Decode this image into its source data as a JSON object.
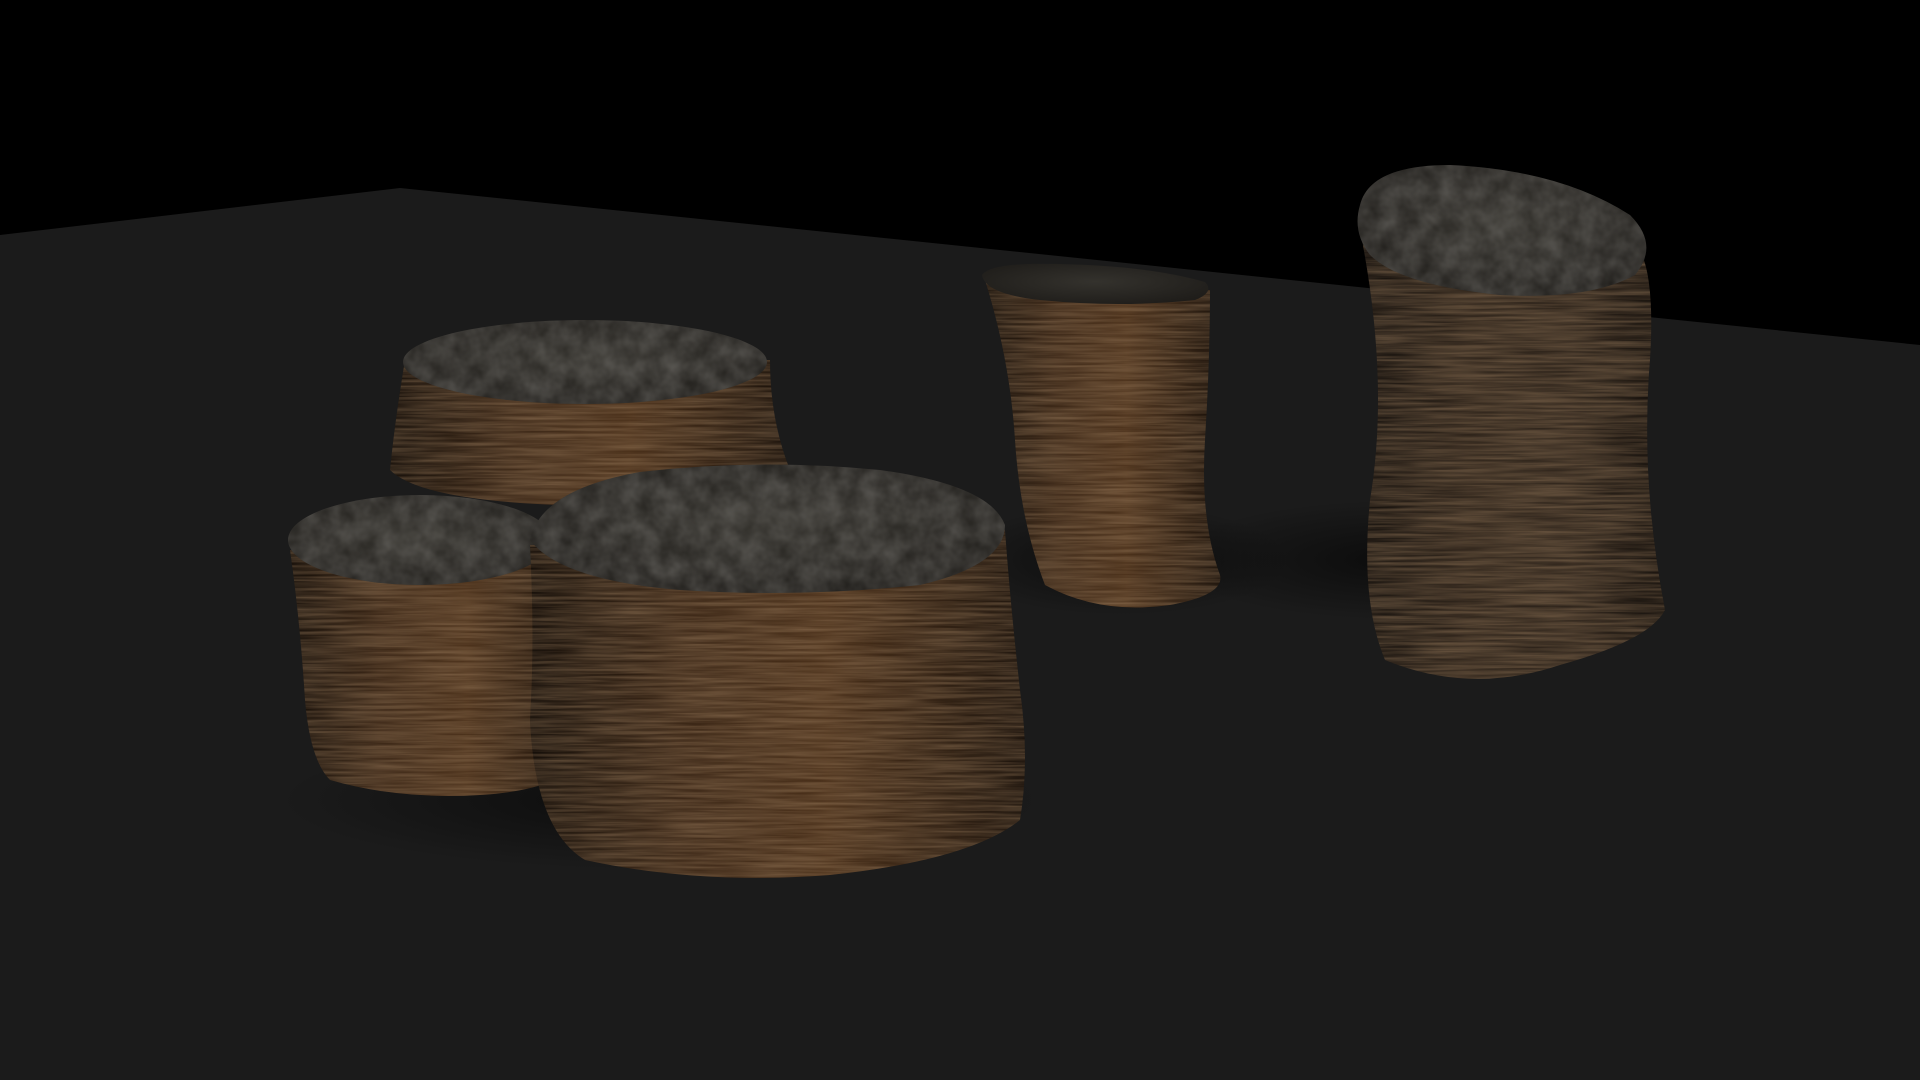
{
  "scene": {
    "kind": "3d-render",
    "background_color": "#000000",
    "floor_color": "#1b1b1b",
    "objects": [
      {
        "name": "tree-stump-back-left",
        "shape": "short-wide-stump"
      },
      {
        "name": "tree-stump-front-left",
        "shape": "short-wide-stump"
      },
      {
        "name": "tree-stump-front-center",
        "shape": "short-wide-stump"
      },
      {
        "name": "tree-stump-tall-middle",
        "shape": "tall-narrow-stump"
      },
      {
        "name": "tree-stump-tall-right",
        "shape": "tall-angled-stump"
      }
    ],
    "colors": {
      "bark_dark": "#1e140d",
      "bark_mid": "#3a2616",
      "bark_light": "#5a3a20",
      "top_cut": "#2b2925",
      "top_cut_light": "#3d3a34"
    }
  }
}
